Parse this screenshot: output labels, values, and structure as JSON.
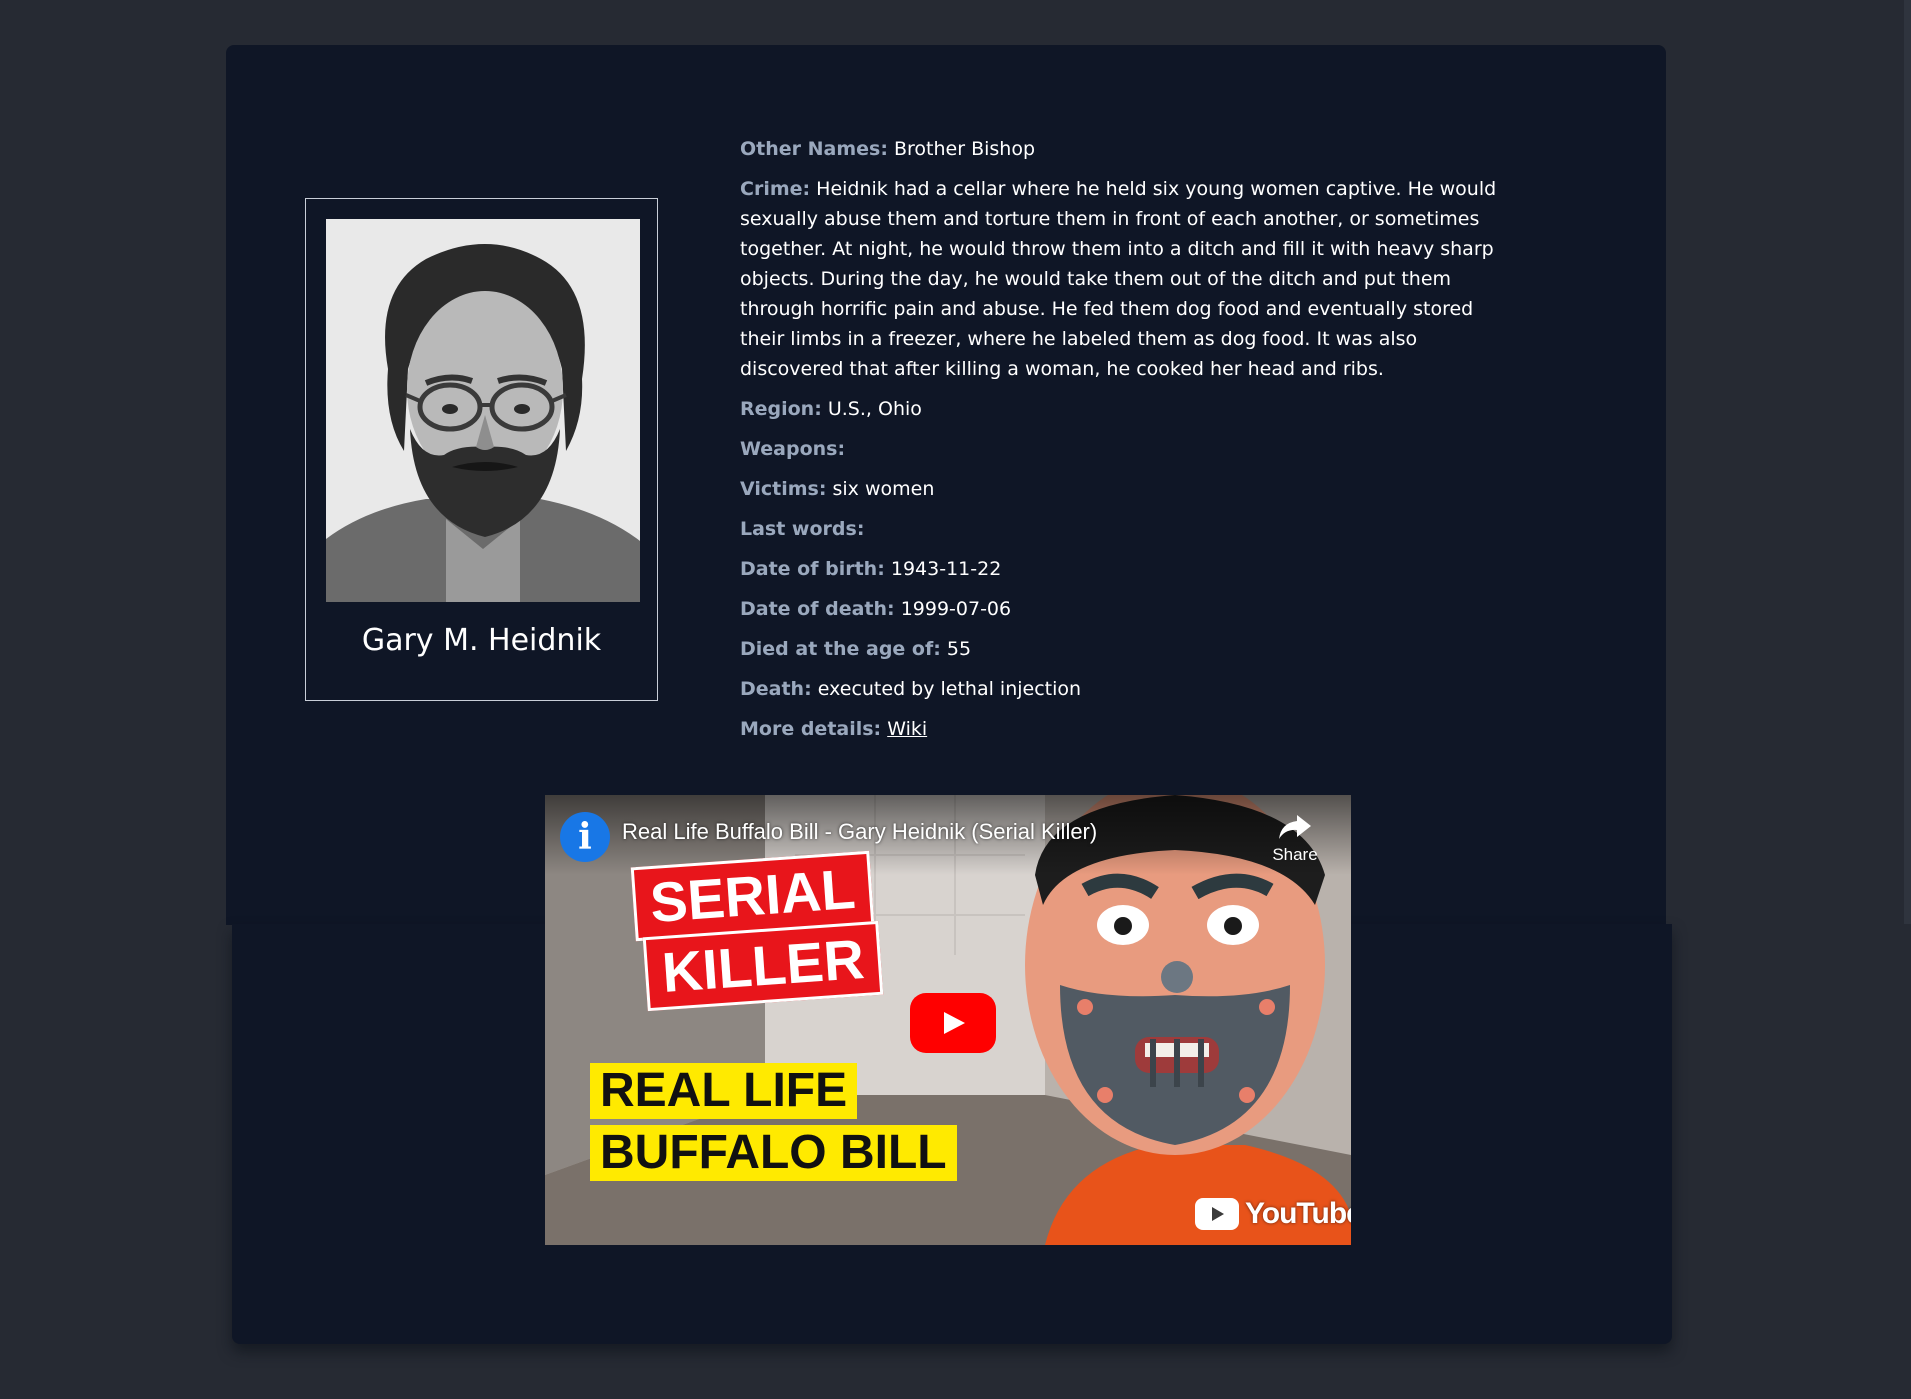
{
  "profile": {
    "name": "Gary M. Heidnik",
    "photo_alt": "Gary M. Heidnik"
  },
  "details": {
    "other_names": {
      "label": "Other Names:",
      "value": "Brother Bishop"
    },
    "crime": {
      "label": "Crime:",
      "value": "Heidnik had a cellar where he held six young women captive. He would sexually abuse them and torture them in front of each another, or sometimes together. At night, he would throw them into a ditch and fill it with heavy sharp objects. During the day, he would take them out of the ditch and put them through horrific pain and abuse. He fed them dog food and eventually stored their limbs in a freezer, where he labeled them as dog food. It was also discovered that after killing a woman, he cooked her head and ribs."
    },
    "region": {
      "label": "Region:",
      "value": "U.S., Ohio"
    },
    "weapons": {
      "label": "Weapons:",
      "value": ""
    },
    "victims": {
      "label": "Victims:",
      "value": "six women"
    },
    "last_words": {
      "label": "Last words:",
      "value": ""
    },
    "date_of_birth": {
      "label": "Date of birth:",
      "value": "1943-11-22"
    },
    "date_of_death": {
      "label": "Date of death:",
      "value": "1999-07-06"
    },
    "age_at_death": {
      "label": "Died at the age of:",
      "value": "55"
    },
    "death": {
      "label": "Death:",
      "value": "executed by lethal injection"
    },
    "more_details": {
      "label": "More details:",
      "link_text": "Wiki"
    }
  },
  "video": {
    "title": "Real Life Buffalo Bill - Gary Heidnik (Serial Killer)",
    "channel_icon": "i",
    "share_label": "Share",
    "thumb_text_1": "SERIAL",
    "thumb_text_2": "KILLER",
    "thumb_text_3": "REAL LIFE",
    "thumb_text_4": "BUFFALO BILL",
    "youtube_label": "YouTube"
  },
  "colors": {
    "page_background": "#262a33",
    "card_background": "#0f1626",
    "label": "#9aa8bd",
    "youtube_red": "#ff0000",
    "thumb_yellow": "#ffea00",
    "thumb_red": "#e8151b"
  }
}
